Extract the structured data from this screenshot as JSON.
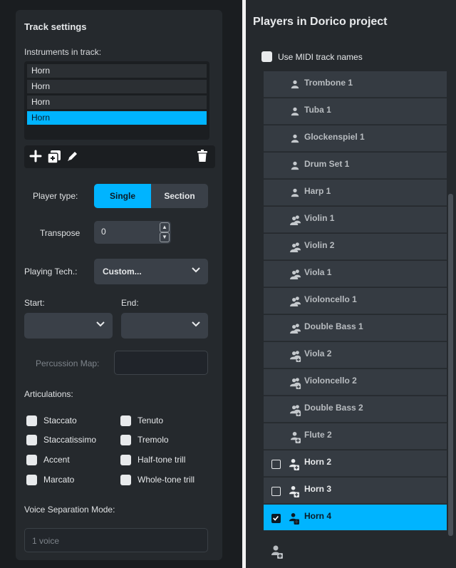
{
  "track_settings": {
    "title": "Track settings",
    "instruments_label": "Instruments in track:",
    "instruments": [
      "Horn",
      "Horn",
      "Horn",
      "Horn"
    ],
    "selected_instrument_index": 3,
    "player_type_label": "Player type:",
    "player_type_options": [
      "Single",
      "Section"
    ],
    "player_type_selected": "Single",
    "transpose_label": "Transpose",
    "transpose_value": "0",
    "playing_tech_label": "Playing Tech.:",
    "playing_tech_value": "Custom...",
    "start_label": "Start:",
    "end_label": "End:",
    "percussion_map_label": "Percussion Map:",
    "articulations_label": "Articulations:",
    "articulations": [
      "Staccato",
      "Tenuto",
      "Staccatissimo",
      "Tremolo",
      "Accent",
      "Half-tone trill",
      "Marcato",
      "Whole-tone trill"
    ],
    "voice_separation_label": "Voice Separation Mode:",
    "voice_separation_value": "1 voice"
  },
  "players_panel": {
    "title": "Players in Dorico project",
    "use_midi_label": "Use MIDI track names",
    "players": [
      {
        "name": "Trombone 1",
        "icon": "single-player-icon",
        "state": "disabled"
      },
      {
        "name": "Tuba 1",
        "icon": "single-player-icon",
        "state": "disabled"
      },
      {
        "name": "Glockenspiel 1",
        "icon": "single-player-icon",
        "state": "disabled"
      },
      {
        "name": "Drum Set 1",
        "icon": "single-player-icon",
        "state": "disabled"
      },
      {
        "name": "Harp 1",
        "icon": "single-player-icon",
        "state": "disabled"
      },
      {
        "name": "Violin 1",
        "icon": "section-player-icon",
        "state": "disabled"
      },
      {
        "name": "Violin 2",
        "icon": "section-player-icon",
        "state": "disabled"
      },
      {
        "name": "Viola 1",
        "icon": "section-player-icon",
        "state": "disabled"
      },
      {
        "name": "Violoncello 1",
        "icon": "section-player-icon",
        "state": "disabled"
      },
      {
        "name": "Double Bass 1",
        "icon": "section-player-icon",
        "state": "disabled"
      },
      {
        "name": "Viola 2",
        "icon": "new-section-player-icon",
        "state": "disabled"
      },
      {
        "name": "Violoncello 2",
        "icon": "new-section-player-icon",
        "state": "disabled"
      },
      {
        "name": "Double Bass 2",
        "icon": "new-section-player-icon",
        "state": "disabled"
      },
      {
        "name": "Flute 2",
        "icon": "new-player-icon",
        "state": "disabled"
      },
      {
        "name": "Horn 2",
        "icon": "new-player-icon",
        "state": "unchecked"
      },
      {
        "name": "Horn 3",
        "icon": "new-player-icon",
        "state": "unchecked"
      },
      {
        "name": "Horn 4",
        "icon": "new-player-icon",
        "state": "checked"
      }
    ]
  },
  "colors": {
    "accent": "#00b4ff",
    "panel": "#25292d",
    "row": "#353b42"
  }
}
